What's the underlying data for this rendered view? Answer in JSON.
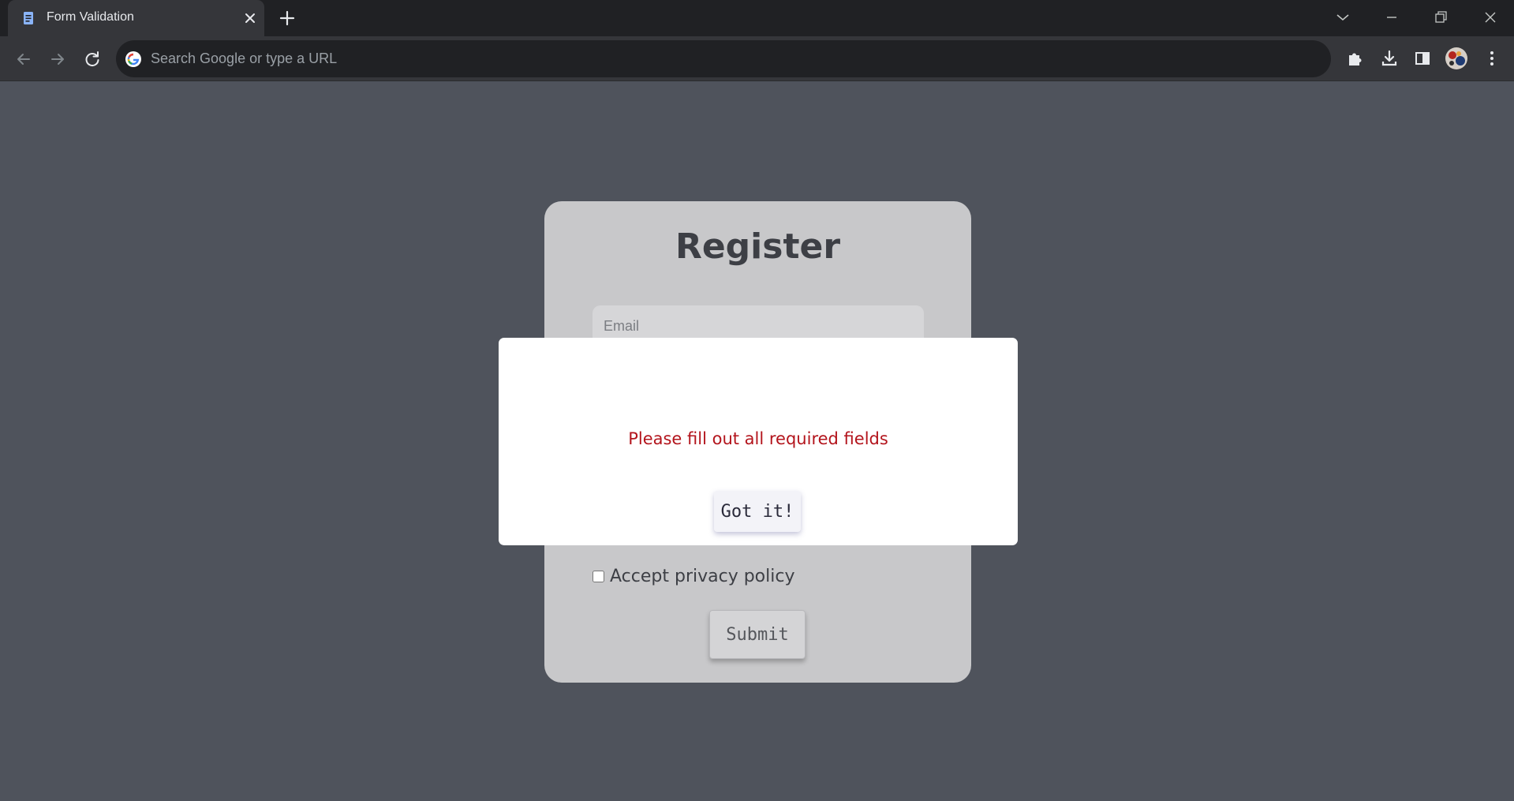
{
  "browser": {
    "tab": {
      "title": "Form Validation",
      "favicon": "document-icon"
    },
    "omnibox": {
      "placeholder": "Search Google or type a URL",
      "value": ""
    },
    "icons": {
      "back": "arrow-left-icon",
      "forward": "arrow-right-icon",
      "reload": "reload-icon",
      "extensions": "puzzle-icon",
      "downloads": "download-icon",
      "side_panel": "side-panel-icon",
      "profile": "avatar",
      "menu": "kebab-menu-icon"
    }
  },
  "form": {
    "title": "Register",
    "email_placeholder": "Email",
    "privacy_label": "Accept privacy policy",
    "privacy_checked": false,
    "submit_label": "Submit"
  },
  "modal": {
    "message": "Please fill out all required fields",
    "button_label": "Got it!"
  },
  "colors": {
    "page_bg": "#4f535c",
    "card_bg": "#c8c8ca",
    "error_text": "#b3141c",
    "modal_bg": "#ffffff"
  }
}
